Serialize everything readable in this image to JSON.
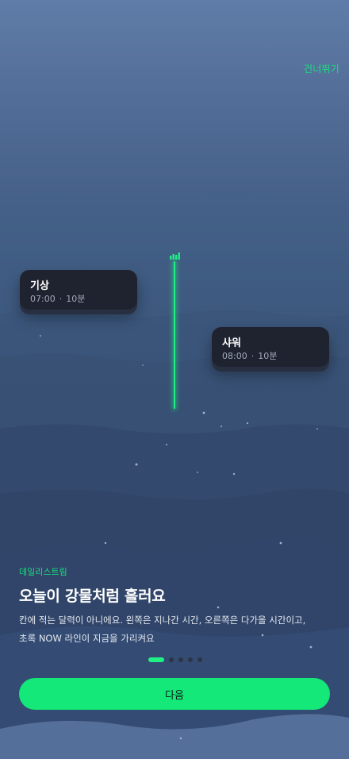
{
  "app": {
    "skip_label": "건너뛰기"
  },
  "timeline": {
    "cards": [
      {
        "title": "기상",
        "time": "07:00",
        "separator": "·",
        "duration": "10분"
      },
      {
        "title": "샤워",
        "time": "08:00",
        "separator": "·",
        "duration": "10분"
      }
    ],
    "now_indicator_icon": "signal-bars-icon"
  },
  "onboarding": {
    "eyebrow": "데일리스트림",
    "headline": "오늘이 강물처럼 흘러요",
    "body_line1": "칸에 적는 달력이 아니에요. 왼쪽은 지나간 시간, 오른쪽은 다가올 시간이고,",
    "body_line2": "초록 NOW 라인이 지금을 가리켜요",
    "page_total": 5,
    "page_current": 1,
    "next_label": "다음"
  },
  "colors": {
    "accent": "#19e07a",
    "card_bg": "#1f2330",
    "button_bg": "#13e878"
  }
}
